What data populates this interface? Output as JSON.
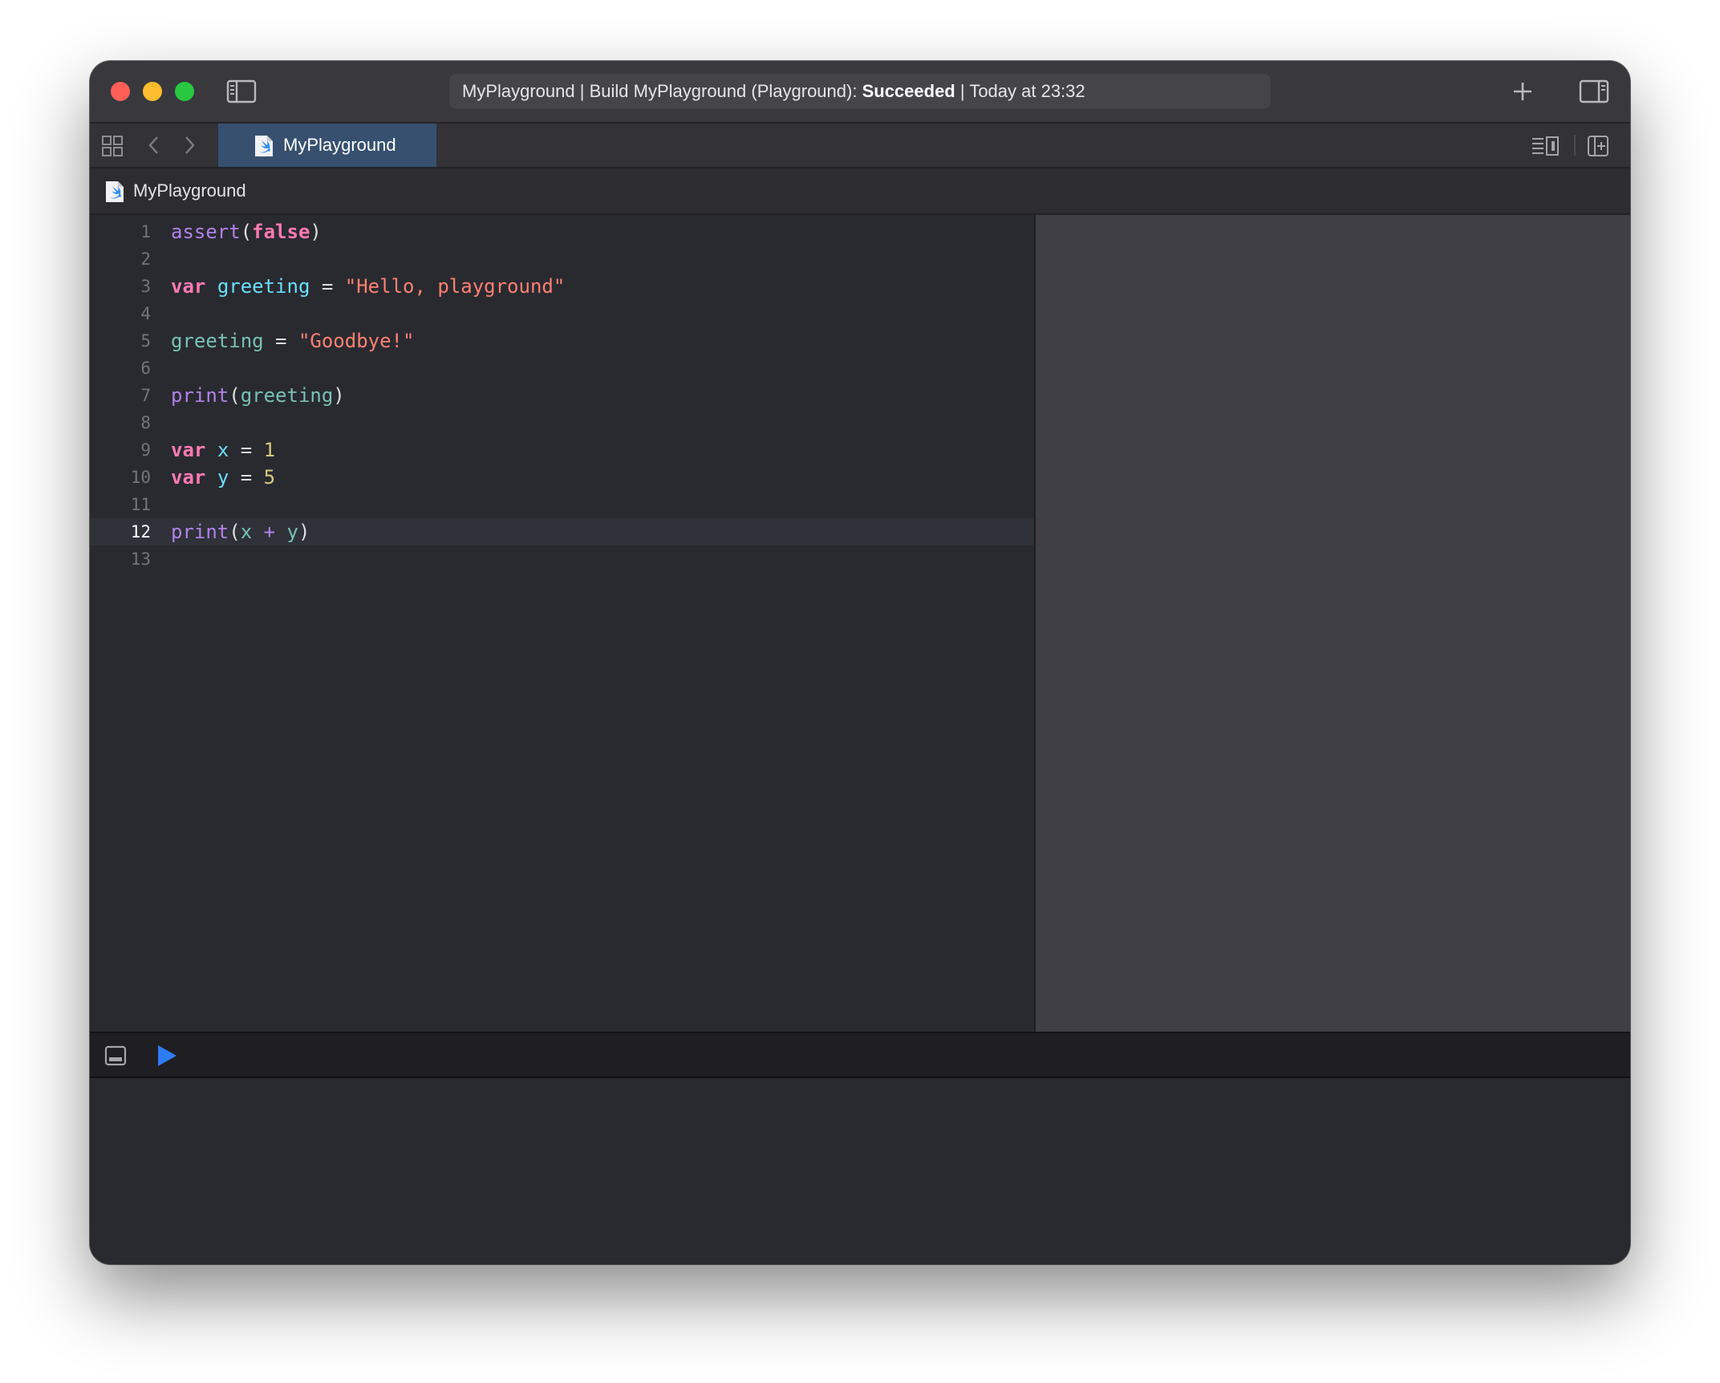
{
  "titlebar": {
    "status_project": "MyPlayground",
    "status_action": "Build MyPlayground (Playground):",
    "status_result": "Succeeded",
    "status_time": "Today at 23:32",
    "separator": "|"
  },
  "tab": {
    "label": "MyPlayground"
  },
  "jumpbar": {
    "label": "MyPlayground"
  },
  "editor": {
    "current_line": 12,
    "lines": [
      {
        "n": "1",
        "tokens": [
          [
            "fn",
            "assert"
          ],
          [
            "pl",
            "("
          ],
          [
            "kw",
            "false"
          ],
          [
            "pl",
            ")"
          ]
        ]
      },
      {
        "n": "2",
        "tokens": []
      },
      {
        "n": "3",
        "tokens": [
          [
            "kw",
            "var"
          ],
          [
            "pl",
            " "
          ],
          [
            "id",
            "greeting"
          ],
          [
            "pl",
            " = "
          ],
          [
            "str",
            "\"Hello, playground\""
          ]
        ]
      },
      {
        "n": "4",
        "tokens": []
      },
      {
        "n": "5",
        "tokens": [
          [
            "id2",
            "greeting"
          ],
          [
            "pl",
            " = "
          ],
          [
            "str",
            "\"Goodbye!\""
          ]
        ]
      },
      {
        "n": "6",
        "tokens": []
      },
      {
        "n": "7",
        "tokens": [
          [
            "fn",
            "print"
          ],
          [
            "pl",
            "("
          ],
          [
            "id2",
            "greeting"
          ],
          [
            "pl",
            ")"
          ]
        ]
      },
      {
        "n": "8",
        "tokens": []
      },
      {
        "n": "9",
        "tokens": [
          [
            "kw",
            "var"
          ],
          [
            "pl",
            " "
          ],
          [
            "id",
            "x"
          ],
          [
            "pl",
            " = "
          ],
          [
            "num",
            "1"
          ]
        ]
      },
      {
        "n": "10",
        "tokens": [
          [
            "kw",
            "var"
          ],
          [
            "pl",
            " "
          ],
          [
            "id",
            "y"
          ],
          [
            "pl",
            " = "
          ],
          [
            "num",
            "5"
          ]
        ]
      },
      {
        "n": "11",
        "tokens": []
      },
      {
        "n": "12",
        "tokens": [
          [
            "fn",
            "print"
          ],
          [
            "pl",
            "("
          ],
          [
            "id2",
            "x"
          ],
          [
            "pl",
            " "
          ],
          [
            "fn",
            "+"
          ],
          [
            "pl",
            " "
          ],
          [
            "id2",
            "y"
          ],
          [
            "pl",
            ")"
          ]
        ]
      },
      {
        "n": "13",
        "tokens": []
      }
    ]
  },
  "icons": {
    "close": "close-button-icon",
    "minimize": "minimize-button-icon",
    "maximize": "zoom-button-icon",
    "sidebar": "navigator-sidebar-icon",
    "add": "plus-icon",
    "inspector": "inspector-sidebar-icon",
    "related": "related-items-grid-icon",
    "back": "chevron-left-icon",
    "forward": "chevron-right-icon",
    "swift_file": "swift-file-icon",
    "minimap": "editor-options-icon",
    "add_editor": "add-editor-icon",
    "toggle_console": "hide-debug-area-icon",
    "run": "play-icon"
  },
  "colors": {
    "keyword": "#ff7ab2",
    "function": "#b281eb",
    "string": "#ff8170",
    "number": "#d9c97c",
    "identifier": "#6bdfff",
    "run_accent": "#2f7bf5",
    "close": "#ff5f57",
    "minimize": "#febc2e",
    "maximize": "#28c840"
  }
}
